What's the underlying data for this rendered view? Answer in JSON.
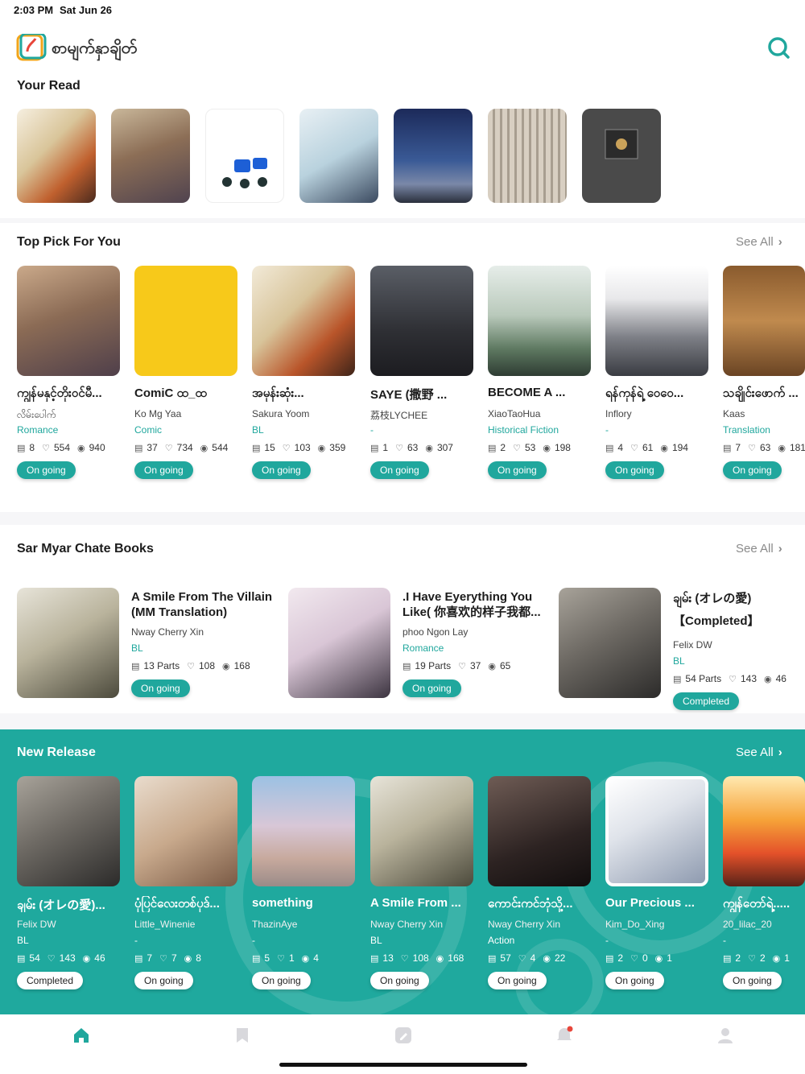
{
  "status": {
    "time": "2:03 PM",
    "date": "Sat Jun 26"
  },
  "app": {
    "name": "စာမျက်နှာချိတ်",
    "accent": "#20a79d"
  },
  "your_read": {
    "title": "Your Read"
  },
  "top_pick": {
    "title": "Top Pick For You",
    "see_all": "See All",
    "items": [
      {
        "title": "ကျွန်မနှင့်တိုးဝင်မီ...",
        "author": "လိမ်းပေါက်",
        "genre": "Romance",
        "parts": "8",
        "likes": "554",
        "views": "940",
        "status": "On going"
      },
      {
        "title": "ComiC ထ_ထ",
        "author": "Ko Mg Yaa",
        "genre": "Comic",
        "parts": "37",
        "likes": "734",
        "views": "544",
        "status": "On going"
      },
      {
        "title": "အမုန်းဆုံး...",
        "author": "Sakura Yoom",
        "genre": "BL",
        "parts": "15",
        "likes": "103",
        "views": "359",
        "status": "On going"
      },
      {
        "title": "SAYE (撒野 ...",
        "author": "荔枝LYCHEE",
        "genre": "-",
        "parts": "1",
        "likes": "63",
        "views": "307",
        "status": "On going"
      },
      {
        "title": "BECOME A ...",
        "author": "XiaoTaoHua",
        "genre": "Historical Fiction",
        "parts": "2",
        "likes": "53",
        "views": "198",
        "status": "On going"
      },
      {
        "title": "ရန်ကုန်ရဲ့ ဝေဝေ...",
        "author": "Inflory",
        "genre": "-",
        "parts": "4",
        "likes": "61",
        "views": "194",
        "status": "On going"
      },
      {
        "title": "သချိုင်းဖောက် ...",
        "author": "Kaas",
        "genre": "Translation",
        "parts": "7",
        "likes": "63",
        "views": "181",
        "status": "On going"
      }
    ]
  },
  "sar_myar": {
    "title": "Sar Myar Chate Books",
    "see_all": "See All",
    "items": [
      {
        "title": "A Smile From The Villain (MM Translation)",
        "author": "Nway Cherry Xin",
        "genre": "BL",
        "parts": "13 Parts",
        "likes": "108",
        "views": "168",
        "status": "On going"
      },
      {
        "title": ".I Have Eyerything You Like( 你喜欢的样子我都...",
        "author": "phoo Ngon Lay",
        "genre": "Romance",
        "parts": "19 Parts",
        "likes": "37",
        "views": "65",
        "status": "On going"
      },
      {
        "title": "ချမ်း (オレの愛) 【Completed】",
        "author": "Felix DW",
        "genre": "BL",
        "parts": "54 Parts",
        "likes": "143",
        "views": "46",
        "status": "Completed"
      }
    ]
  },
  "new_release": {
    "title": "New Release",
    "see_all": "See All",
    "items": [
      {
        "title": "ချမ်း (オレの愛)...",
        "author": "Felix DW",
        "genre": "BL",
        "parts": "54",
        "likes": "143",
        "views": "46",
        "status": "Completed"
      },
      {
        "title": "ပုံပြင်လေးတစ်ပုဒ်...",
        "author": "Little_Winenie",
        "genre": "-",
        "parts": "7",
        "likes": "7",
        "views": "8",
        "status": "On going"
      },
      {
        "title": "something",
        "author": "ThazinAye",
        "genre": "-",
        "parts": "5",
        "likes": "1",
        "views": "4",
        "status": "On going"
      },
      {
        "title": "A Smile From ...",
        "author": "Nway Cherry Xin",
        "genre": "BL",
        "parts": "13",
        "likes": "108",
        "views": "168",
        "status": "On going"
      },
      {
        "title": "ကောင်းကင်ဘုံသို့...",
        "author": "Nway Cherry Xin",
        "genre": "Action",
        "parts": "57",
        "likes": "4",
        "views": "22",
        "status": "On going"
      },
      {
        "title": "Our Precious ...",
        "author": "Kim_Do_Xing",
        "genre": "-",
        "parts": "2",
        "likes": "0",
        "views": "1",
        "status": "On going"
      },
      {
        "title": "ကျွန်တော်ရဲ့.....",
        "author": "20_lilac_20",
        "genre": "-",
        "parts": "2",
        "likes": "2",
        "views": "1",
        "status": "On going"
      }
    ]
  },
  "tabs": [
    {
      "name": "home-icon",
      "active": true
    },
    {
      "name": "library-icon",
      "active": false
    },
    {
      "name": "write-icon",
      "active": false
    },
    {
      "name": "notification-icon",
      "active": false
    },
    {
      "name": "profile-icon",
      "active": false
    }
  ]
}
